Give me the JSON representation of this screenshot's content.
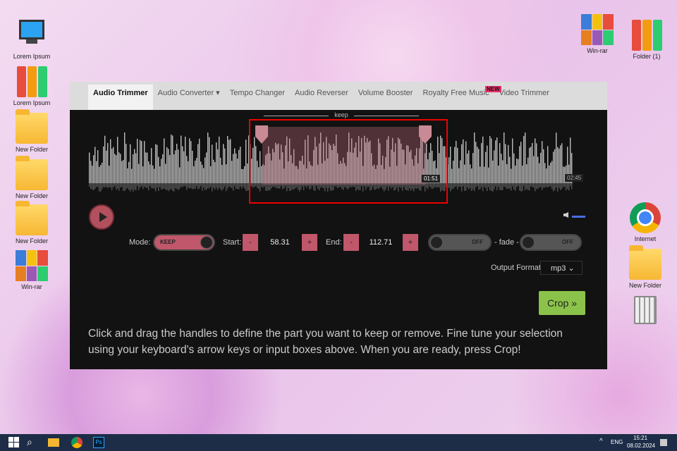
{
  "desktop": {
    "left_icons": [
      {
        "label": "Lorem Ipsum",
        "type": "computer"
      },
      {
        "label": "Lorem Ipsum",
        "type": "binders"
      },
      {
        "label": "New Folder",
        "type": "folder"
      },
      {
        "label": "New Folder",
        "type": "folder"
      },
      {
        "label": "New Folder",
        "type": "folder"
      },
      {
        "label": "Win-rar",
        "type": "rar"
      }
    ],
    "right_icons": [
      {
        "label": "Win-rar",
        "type": "rar"
      },
      {
        "label": "Folder (1)",
        "type": "binders"
      },
      {
        "label": "Internet",
        "type": "chrome"
      },
      {
        "label": "New Folder",
        "type": "folder"
      },
      {
        "label": "",
        "type": "recycle-bin"
      }
    ]
  },
  "nav": {
    "tabs": [
      "Audio Trimmer",
      "Audio Converter ▾",
      "Tempo Changer",
      "Audio Reverser",
      "Volume Booster",
      "Royalty Free Music",
      "Video Trimmer"
    ],
    "badge": "NEW"
  },
  "editor": {
    "region_label": "keep",
    "selection_time": "01:51",
    "duration": "02:45",
    "selection_start_fraction": 0.34,
    "selection_end_fraction": 0.69
  },
  "controls": {
    "mode_label": "Mode:",
    "mode_value": "KEEP",
    "start_label": "Start:",
    "start_value": "58.31",
    "end_label": "End:",
    "end_value": "112.71",
    "minus": "-",
    "plus": "+",
    "fade_in": "OFF",
    "fade_label": "- fade -",
    "fade_out": "OFF",
    "output_label": "Output Format",
    "output_value": "mp3 ⌄"
  },
  "crop_label": "Crop »",
  "help": "Click and drag the handles to define the part you want to keep or remove. Fine tune your selection using your keyboard's arrow keys or input boxes above. When you are ready, press Crop!",
  "taskbar": {
    "lang": "ENG",
    "time": "15:21",
    "date": "08.02.2024",
    "tray": "^"
  }
}
